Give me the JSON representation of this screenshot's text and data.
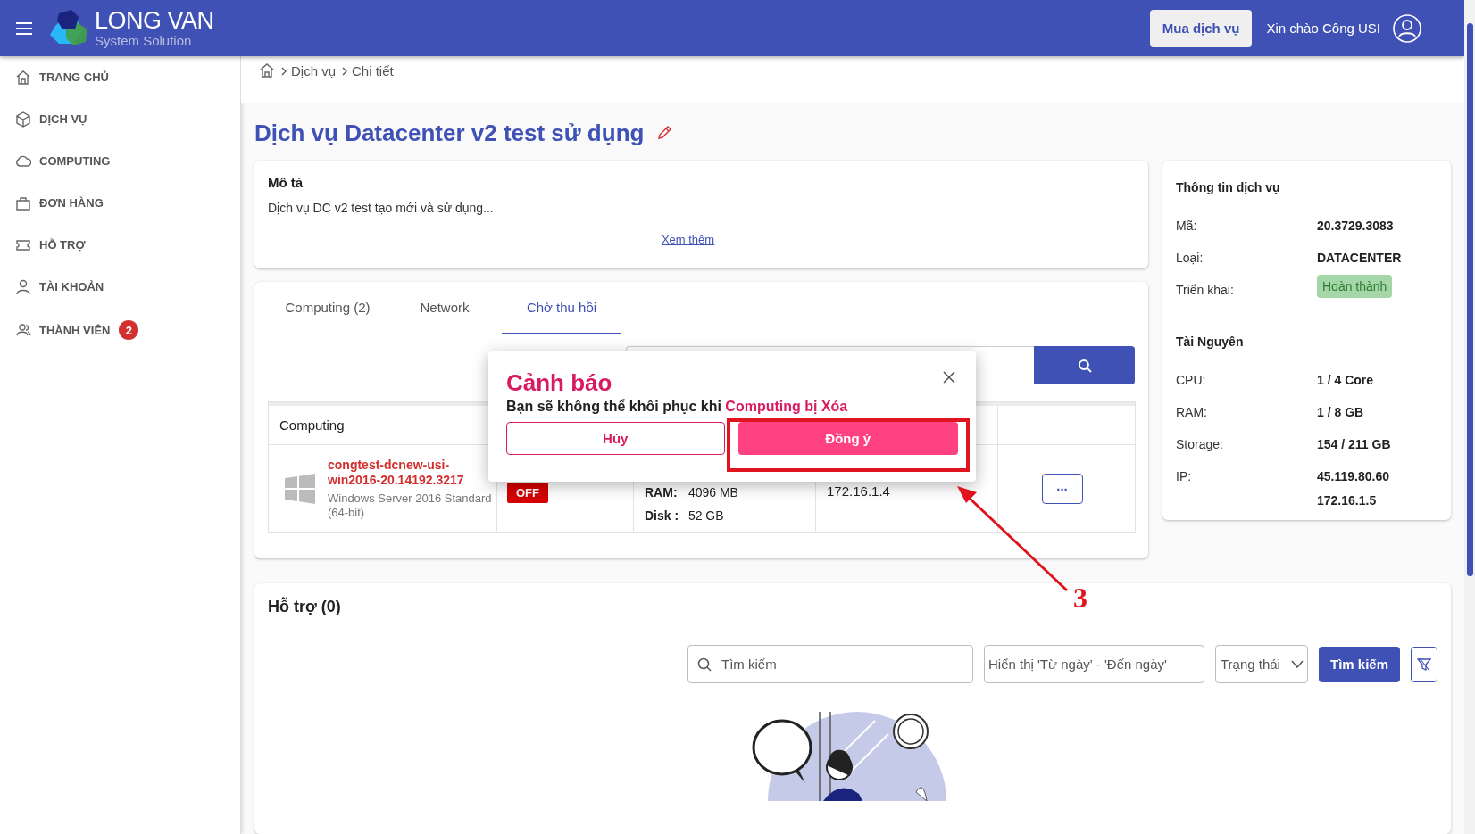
{
  "header": {
    "brand_name": "LONG VAN",
    "brand_tagline": "System Solution",
    "buy_button": "Mua dịch vụ",
    "greeting": "Xin chào Công USI"
  },
  "sidebar": {
    "items": [
      {
        "label": "TRANG CHỦ",
        "selected": false
      },
      {
        "label": "DỊCH VỤ",
        "selected": false
      },
      {
        "label": "COMPUTING",
        "selected": false
      },
      {
        "label": "ĐƠN HÀNG",
        "selected": false
      },
      {
        "label": "HỖ TRỢ",
        "selected": false
      },
      {
        "label": "TÀI KHOẢN",
        "selected": false
      },
      {
        "label": "THÀNH VIÊN",
        "selected": false,
        "badge": "2"
      }
    ]
  },
  "breadcrumb": [
    "Dịch vụ",
    "Chi tiết"
  ],
  "page_title": "Dịch vụ Datacenter v2 test sử dụng",
  "description": {
    "heading": "Mô tả",
    "text": "Dịch vụ DC v2 test tạo mới và sử dụng...",
    "more_link": "Xem thêm"
  },
  "tabs": [
    {
      "label": "Computing (2)",
      "selected": false
    },
    {
      "label": "Network",
      "selected": false
    },
    {
      "label": "Chờ thu hồi",
      "selected": true
    }
  ],
  "table": {
    "columns": [
      "Computing"
    ],
    "rows": [
      {
        "name": "congtest-dcnew-usi-win2016-20.14192.3217",
        "os": "Windows Server 2016 Standard (64-bit)",
        "status": "OFF",
        "ram_label": "RAM:",
        "ram": "4096 MB",
        "disk_label": "Disk :",
        "disk": "52 GB",
        "ip": "172.16.1.4",
        "menu": "..."
      }
    ]
  },
  "dialog": {
    "title": "Cảnh báo",
    "message": "Bạn sẽ không thể khôi phục khi",
    "highlight": "Computing bị Xóa",
    "cancel": "Hủy",
    "confirm": "Đồng ý"
  },
  "annotation": {
    "label": "3"
  },
  "service_info": {
    "title": "Thông tin dịch vụ",
    "rows": [
      {
        "label": "Mã:",
        "value": "20.3729.3083",
        "kind": "text"
      },
      {
        "label": "Loại:",
        "value": "DATACENTER",
        "kind": "text"
      },
      {
        "label": "Triển khai:",
        "value": "Hoàn thành",
        "kind": "badge"
      }
    ]
  },
  "resources": {
    "title": "Tài Nguyên",
    "rows": [
      {
        "label": "CPU:",
        "values": [
          "1 / 4 Core"
        ]
      },
      {
        "label": "RAM:",
        "values": [
          "1 / 8 GB"
        ]
      },
      {
        "label": "Storage:",
        "values": [
          "154 / 211 GB"
        ]
      },
      {
        "label": "IP:",
        "values": [
          "45.119.80.60",
          "172.16.1.5"
        ]
      }
    ]
  },
  "support": {
    "title": "Hỗ trợ (0)",
    "search_placeholder": "Tìm kiếm",
    "date_placeholder": "Hiển thị 'Từ ngày' - 'Đến ngày'",
    "status_placeholder": "Trạng thái",
    "search_button": "Tìm kiếm"
  }
}
